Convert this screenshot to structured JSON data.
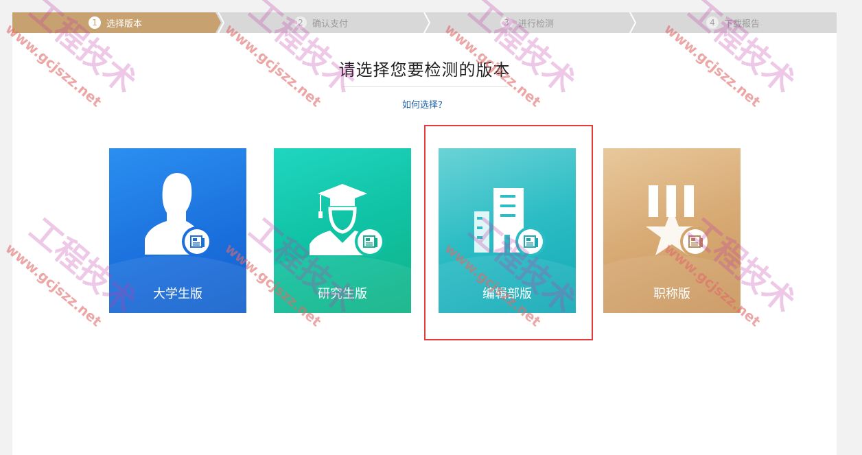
{
  "steps": [
    {
      "num": "1",
      "label": "选择版本",
      "active": true
    },
    {
      "num": "2",
      "label": "确认支付",
      "active": false
    },
    {
      "num": "3",
      "label": "进行检测",
      "active": false
    },
    {
      "num": "4",
      "label": "下载报告",
      "active": false
    }
  ],
  "heading": "请选择您要检测的版本",
  "help_link": "如何选择？",
  "cards": [
    {
      "label": "大学生版",
      "icon": "student-silhouette-icon"
    },
    {
      "label": "研究生版",
      "icon": "graduate-cap-icon"
    },
    {
      "label": "编辑部版",
      "icon": "buildings-icon"
    },
    {
      "label": "职称版",
      "icon": "medal-star-icon"
    }
  ],
  "watermark": {
    "brand": "工程技术",
    "site": "www.gcjszz.net"
  },
  "colors": {
    "step_active": "#c8a170",
    "step_inactive": "#d8d8d8",
    "highlight_border": "#e33a3a",
    "link": "#1f5fa8"
  }
}
